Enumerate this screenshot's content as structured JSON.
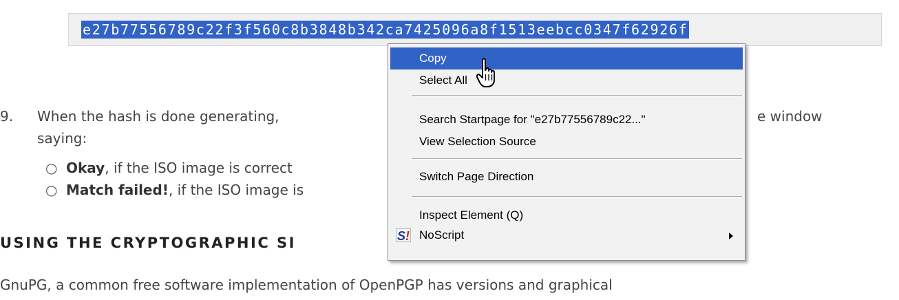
{
  "hash_box": {
    "hash": "e27b77556789c22f3f560c8b3848b342ca7425096a8f1513eebcc0347f62926f"
  },
  "step9": {
    "number": "9.",
    "line1_left": "When the hash is done generating,",
    "line1_right": "e window",
    "line2": "saying:"
  },
  "bullets": [
    {
      "bold": "Okay",
      "rest": ", if the ISO image is correct"
    },
    {
      "bold": "Match failed!",
      "rest": ", if the ISO image is"
    }
  ],
  "heading": "USING THE CRYPTOGRAPHIC SI",
  "footer_text": "GnuPG, a common free software implementation of OpenPGP has versions and graphical",
  "context_menu": {
    "copy": "Copy",
    "select_all": "Select All",
    "search": "Search Startpage for \"e27b77556789c22...\"",
    "view_source": "View Selection Source",
    "switch_direction": "Switch Page Direction",
    "inspect": "Inspect Element (Q)",
    "noscript": "NoScript",
    "noscript_icon": "noscript-icon",
    "submenu_icon": "submenu-arrow-icon",
    "cursor_icon": "hand-pointer-icon"
  },
  "colors": {
    "selection": "#3162c6",
    "menu_background": "#f2f2f2"
  }
}
